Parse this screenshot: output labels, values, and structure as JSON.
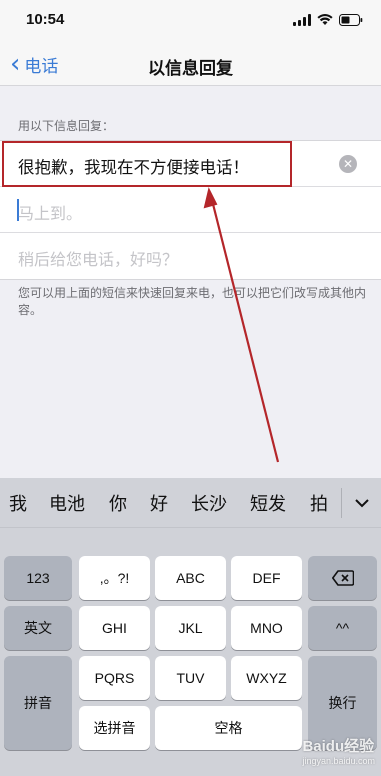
{
  "status": {
    "time": "10:54"
  },
  "nav": {
    "back_label": "电话",
    "title": "以信息回复"
  },
  "section": {
    "header": "用以下信息回复："
  },
  "replies": [
    {
      "text": "很抱歉，我现在不方便接电话！",
      "state": "editing"
    },
    {
      "text": "马上到。",
      "state": "placeholder"
    },
    {
      "text": "稍后给您电话，好吗？",
      "state": "placeholder"
    }
  ],
  "footer_note": "您可以用上面的短信来快速回复来电，也可以把它们改写成其他内容。",
  "keyboard": {
    "candidates": [
      "我",
      "电池",
      "你",
      "好",
      "长沙",
      "短发",
      "拍"
    ],
    "row1": [
      "123",
      ",。?!",
      "ABC",
      "DEF"
    ],
    "row2": [
      "英文",
      "GHI",
      "JKL",
      "MNO",
      "^^"
    ],
    "row3": [
      "拼音",
      "PQRS",
      "TUV",
      "WXYZ",
      "换行"
    ],
    "row4": [
      "选拼音",
      "空格"
    ]
  },
  "watermark": {
    "brand": "Baidu经验",
    "sub": "jingyan.baidu.com"
  },
  "colors": {
    "accent": "#3a7bd5",
    "annotation": "#b4262a"
  }
}
